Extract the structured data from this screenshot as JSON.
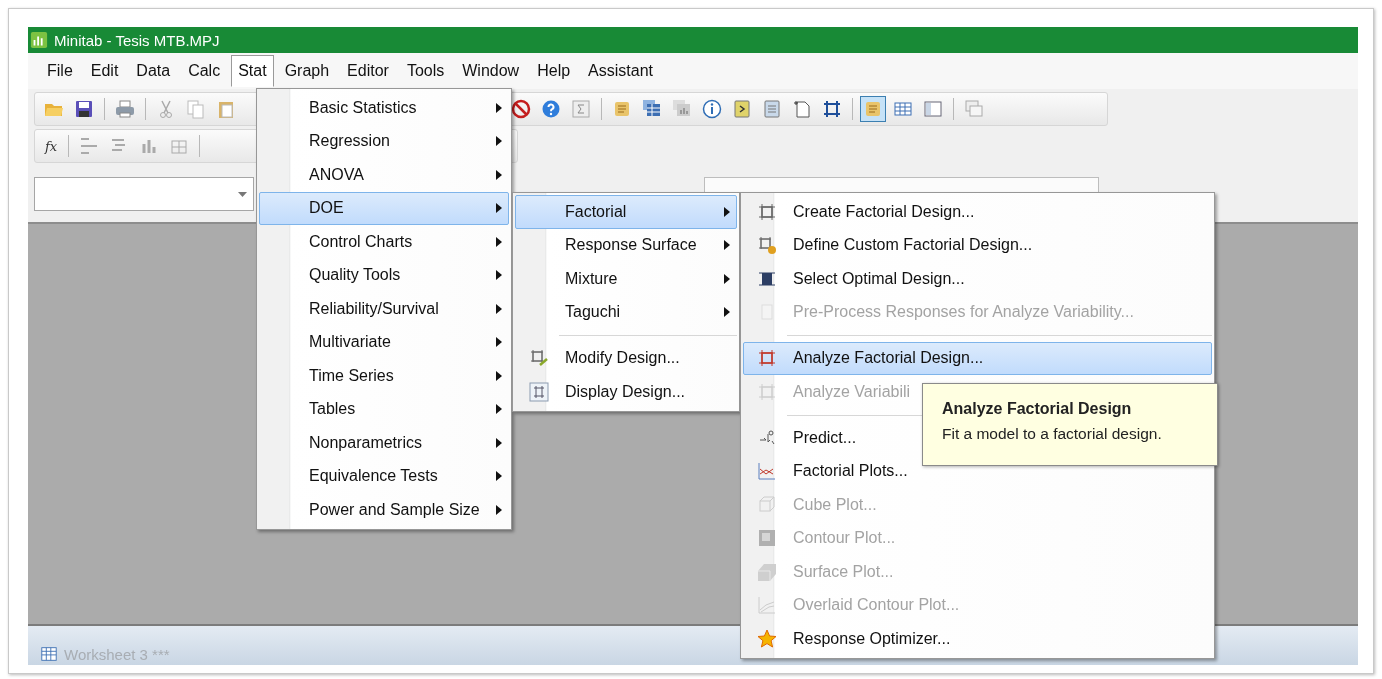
{
  "window": {
    "title": "Minitab - Tesis MTB.MPJ"
  },
  "menu_bar": [
    {
      "label": "File",
      "selected": false
    },
    {
      "label": "Edit",
      "selected": false
    },
    {
      "label": "Data",
      "selected": false
    },
    {
      "label": "Calc",
      "selected": false
    },
    {
      "label": "Stat",
      "selected": true
    },
    {
      "label": "Graph",
      "selected": false
    },
    {
      "label": "Editor",
      "selected": false
    },
    {
      "label": "Tools",
      "selected": false
    },
    {
      "label": "Window",
      "selected": false
    },
    {
      "label": "Help",
      "selected": false
    },
    {
      "label": "Assistant",
      "selected": false
    }
  ],
  "toolbar": [
    {
      "selected": false
    },
    {
      "selected": false
    },
    {
      "selected": false
    },
    {
      "selected": false
    },
    {
      "selected": false
    },
    {
      "selected": false
    },
    {
      "selected": false
    },
    {
      "selected": false
    },
    {
      "selected": false
    },
    {
      "selected": false
    },
    {
      "selected": false
    },
    {
      "selected": false
    },
    {
      "selected": false
    },
    {
      "selected": false
    },
    {
      "selected": false
    },
    {
      "selected": false
    },
    {
      "selected": false
    },
    {
      "selected": true
    },
    {
      "selected": false
    },
    {
      "selected": false
    },
    {
      "selected": false
    }
  ],
  "formula_toolbar": {
    "label": "fx"
  },
  "stat_menu": [
    {
      "label": "Basic Statistics",
      "submenu": true,
      "selected": false
    },
    {
      "label": "Regression",
      "submenu": true,
      "selected": false
    },
    {
      "label": "ANOVA",
      "submenu": true,
      "selected": false
    },
    {
      "label": "DOE",
      "submenu": true,
      "selected": true
    },
    {
      "label": "Control Charts",
      "submenu": true,
      "selected": false
    },
    {
      "label": "Quality Tools",
      "submenu": true,
      "selected": false
    },
    {
      "label": "Reliability/Survival",
      "submenu": true,
      "selected": false
    },
    {
      "label": "Multivariate",
      "submenu": true,
      "selected": false
    },
    {
      "label": "Time Series",
      "submenu": true,
      "selected": false
    },
    {
      "label": "Tables",
      "submenu": true,
      "selected": false
    },
    {
      "label": "Nonparametrics",
      "submenu": true,
      "selected": false
    },
    {
      "label": "Equivalence Tests",
      "submenu": true,
      "selected": false
    },
    {
      "label": "Power and Sample Size",
      "submenu": true,
      "selected": false
    }
  ],
  "doe_menu": [
    {
      "kind": "item",
      "label": "Factorial",
      "submenu": true,
      "selected": true
    },
    {
      "kind": "item",
      "label": "Response Surface",
      "submenu": true,
      "selected": false
    },
    {
      "kind": "item",
      "label": "Mixture",
      "submenu": true,
      "selected": false
    },
    {
      "kind": "item",
      "label": "Taguchi",
      "submenu": true,
      "selected": false
    },
    {
      "kind": "separator"
    },
    {
      "kind": "item",
      "label": "Modify Design...",
      "submenu": false,
      "selected": false
    },
    {
      "kind": "item",
      "label": "Display Design...",
      "submenu": false,
      "selected": false
    }
  ],
  "factorial_menu": [
    {
      "kind": "item",
      "label": "Create Factorial Design...",
      "selected": false,
      "disabled": false
    },
    {
      "kind": "item",
      "label": "Define Custom Factorial Design...",
      "selected": false,
      "disabled": false
    },
    {
      "kind": "item",
      "label": "Select Optimal Design...",
      "selected": false,
      "disabled": false
    },
    {
      "kind": "item",
      "label": "Pre-Process Responses for Analyze Variability...",
      "selected": false,
      "disabled": true
    },
    {
      "kind": "separator"
    },
    {
      "kind": "item",
      "label": "Analyze Factorial Design...",
      "selected": true,
      "disabled": false
    },
    {
      "kind": "item",
      "label": "Analyze Variabili",
      "selected": false,
      "disabled": true
    },
    {
      "kind": "separator"
    },
    {
      "kind": "item",
      "label": "Predict...",
      "selected": false,
      "disabled": false
    },
    {
      "kind": "item",
      "label": "Factorial Plots...",
      "selected": false,
      "disabled": false
    },
    {
      "kind": "item",
      "label": "Cube Plot...",
      "selected": false,
      "disabled": true
    },
    {
      "kind": "item",
      "label": "Contour Plot...",
      "selected": false,
      "disabled": true
    },
    {
      "kind": "item",
      "label": "Surface Plot...",
      "selected": false,
      "disabled": true
    },
    {
      "kind": "item",
      "label": "Overlaid Contour Plot...",
      "selected": false,
      "disabled": true
    },
    {
      "kind": "item",
      "label": "Response Optimizer...",
      "selected": false,
      "disabled": false
    }
  ],
  "tooltip": {
    "title": "Analyze Factorial Design",
    "text": "Fit a model to a factorial design."
  },
  "worksheet_bar": {
    "label": "Worksheet 3 ***"
  }
}
